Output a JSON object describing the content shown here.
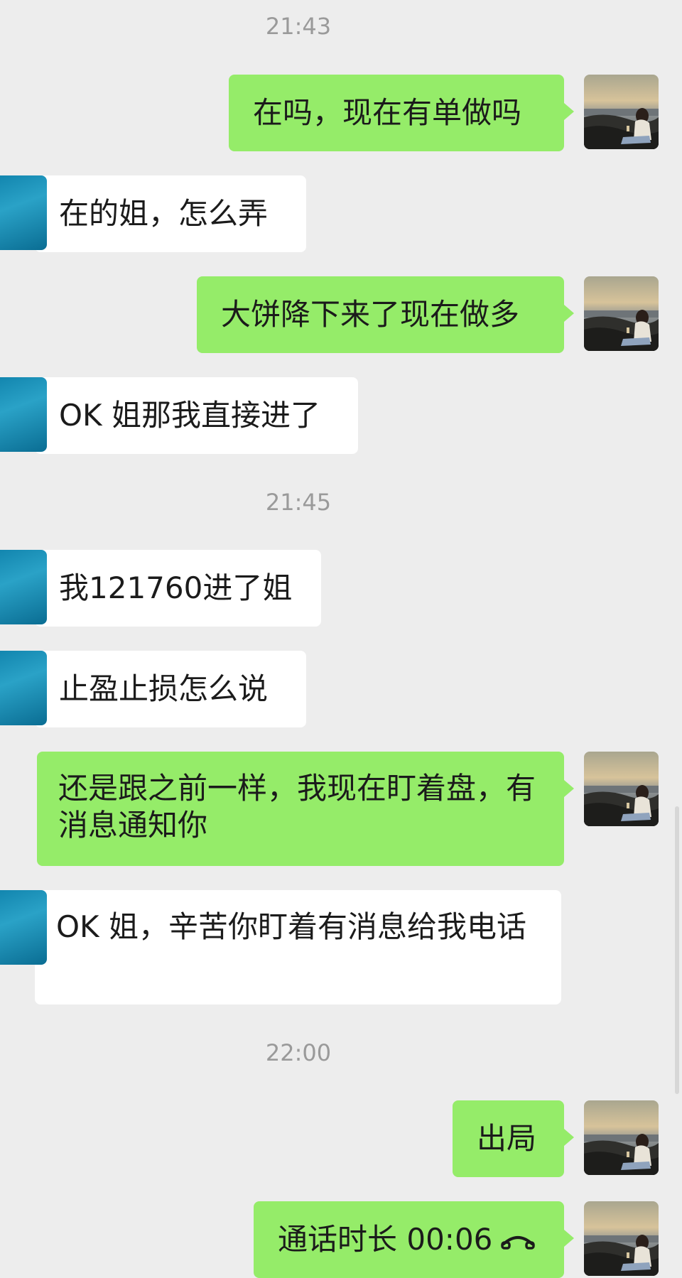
{
  "timestamps": [
    "21:43",
    "21:45",
    "22:00"
  ],
  "messages": {
    "m1": "在吗，现在有单做吗",
    "m2": "在的姐，怎么弄",
    "m3": "大饼降下来了现在做多",
    "m4": "OK 姐那我直接进了",
    "m5": "我121760进了姐",
    "m6": "止盈止损怎么说",
    "m7": "还是跟之前一样，我现在盯着盘，有消息通知你",
    "m8": "OK 姐，辛苦你盯着有消息给我电话",
    "m9": "出局",
    "m10": "通话时长 00:06"
  },
  "colors": {
    "background": "#ededed",
    "outgoing_bubble": "#95ec69",
    "incoming_bubble": "#ffffff",
    "timestamp_text": "#9a9a9a"
  },
  "icons": {
    "call": "phone-hangup-icon"
  }
}
